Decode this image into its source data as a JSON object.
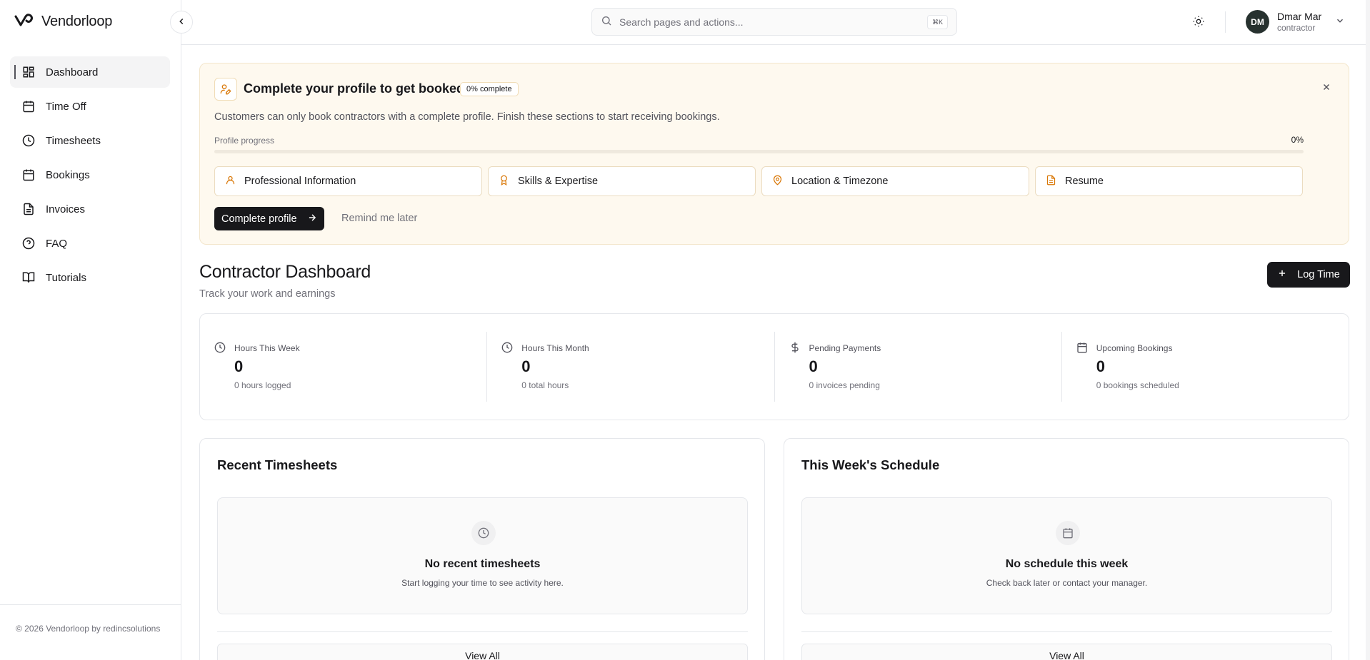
{
  "app": {
    "brand_name": "Vendorloop"
  },
  "sidebar": {
    "items": [
      {
        "label": "Dashboard",
        "icon": "dashboard-icon",
        "active": true
      },
      {
        "label": "Time Off",
        "icon": "calendar-icon"
      },
      {
        "label": "Timesheets",
        "icon": "clock-icon"
      },
      {
        "label": "Bookings",
        "icon": "calendar-icon"
      },
      {
        "label": "Invoices",
        "icon": "file-text-icon"
      },
      {
        "label": "FAQ",
        "icon": "help-circle-icon"
      },
      {
        "label": "Tutorials",
        "icon": "book-open-icon"
      }
    ],
    "footer": "© 2026 Vendorloop by redincsolutions"
  },
  "header": {
    "search_placeholder": "Search pages and actions...",
    "shortcut": "⌘K",
    "user": {
      "initials": "DM",
      "name": "Dmar Mar",
      "role": "contractor"
    }
  },
  "banner": {
    "title": "Complete your profile to get booked",
    "badge": "0% complete",
    "description": "Customers can only book contractors with a complete profile. Finish these sections to start receiving bookings.",
    "progress_label": "Profile progress",
    "progress_value": "0%",
    "progress": 0,
    "sections": [
      {
        "label": "Professional Information",
        "icon": "user-icon"
      },
      {
        "label": "Skills & Expertise",
        "icon": "award-icon"
      },
      {
        "label": "Location & Timezone",
        "icon": "map-pin-icon"
      },
      {
        "label": "Resume",
        "icon": "file-icon"
      }
    ],
    "primary_action": "Complete profile",
    "secondary_action": "Remind me later",
    "accent_color": "#d97706"
  },
  "dashboard": {
    "title": "Contractor Dashboard",
    "subtitle": "Track your work and earnings",
    "log_time": "Log Time"
  },
  "stats": [
    {
      "label": "Hours This Week",
      "value": "0",
      "sub": "0 hours logged",
      "icon": "clock-icon"
    },
    {
      "label": "Hours This Month",
      "value": "0",
      "sub": "0 total hours",
      "icon": "clock-icon"
    },
    {
      "label": "Pending Payments",
      "value": "0",
      "sub": "0 invoices pending",
      "icon": "dollar-icon"
    },
    {
      "label": "Upcoming Bookings",
      "value": "0",
      "sub": "0 bookings scheduled",
      "icon": "calendar-icon"
    }
  ],
  "panels": {
    "timesheets": {
      "title": "Recent Timesheets",
      "empty_title": "No recent timesheets",
      "empty_sub": "Start logging your time to see activity here.",
      "view_all": "View All"
    },
    "schedule": {
      "title": "This Week's Schedule",
      "empty_title": "No schedule this week",
      "empty_sub": "Check back later or contact your manager.",
      "view_all": "View All"
    }
  }
}
